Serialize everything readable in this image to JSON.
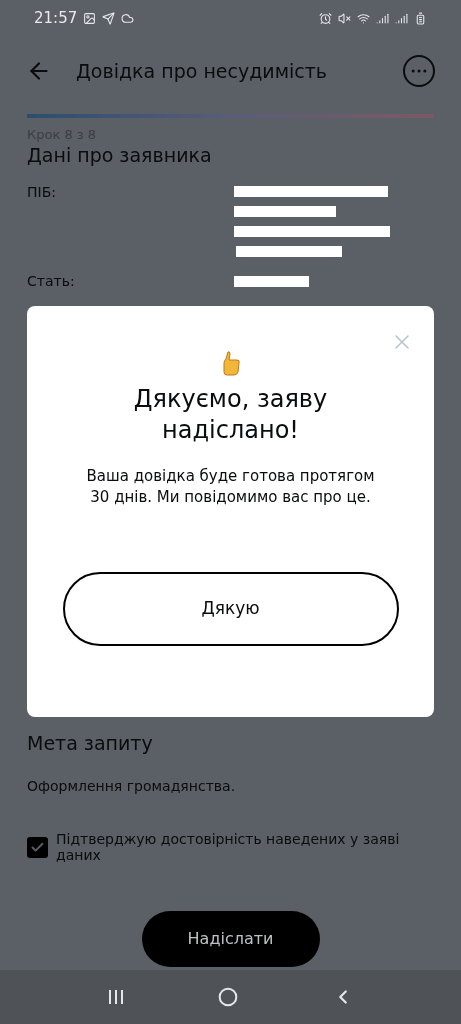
{
  "status_bar": {
    "time": "21:57"
  },
  "header": {
    "title": "Довідка про несудимість"
  },
  "progress": {
    "level": 1
  },
  "step": "Крок 8 з 8",
  "section_title": "Дані про заявника",
  "fields": [
    {
      "label": "ПІБ:"
    },
    {
      "label": "Стать:"
    }
  ],
  "purpose": {
    "title": "Мета запиту",
    "value": "Оформлення громадянства."
  },
  "confirm": {
    "label": "Підтверджую достовірність наведених у заяві даних",
    "checked": true
  },
  "submit_button": "Надіслати",
  "dialog": {
    "title": "Дякуємо, заяву надіслано!",
    "message": "Ваша довідка буде готова протягом 30 днів. Ми повідомимо вас про це.",
    "button": "Дякую"
  }
}
